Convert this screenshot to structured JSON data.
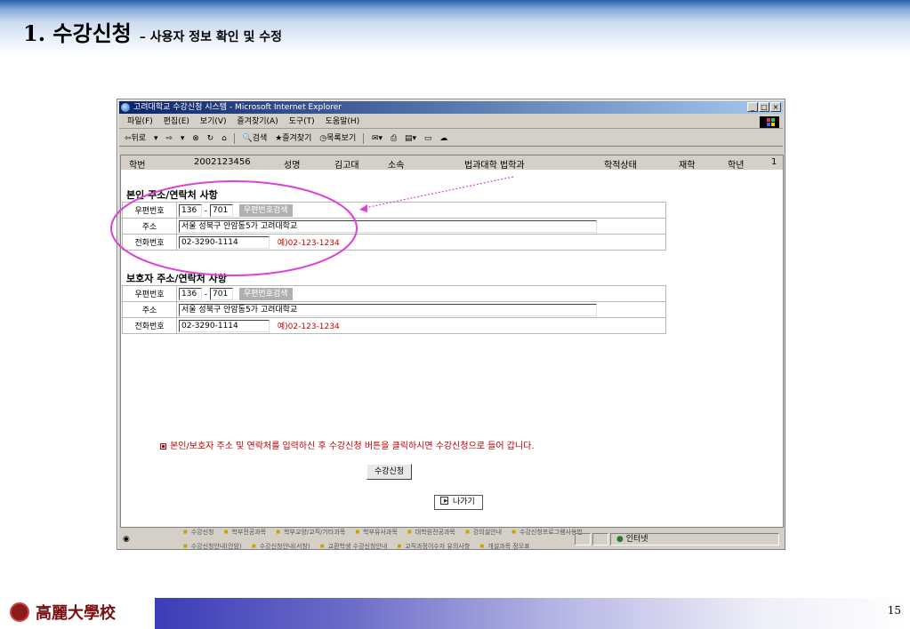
{
  "slide": {
    "title": "1. 수강신청",
    "subtitle": "– 사용자 정보 확인 및 수정",
    "page_number": "15",
    "logo_text": "高麗大學校"
  },
  "browser": {
    "title": "고려대학교 수강신청 시스템 - Microsoft Internet Explorer",
    "menu": [
      "파일(F)",
      "편집(E)",
      "보기(V)",
      "즐겨찾기(A)",
      "도구(T)",
      "도움말(H)"
    ],
    "toolbar": {
      "back": "⇦뒤로",
      "search": "검색",
      "favorites": "즐겨찾기",
      "history": "목록보기"
    },
    "status_zone": "인터넷"
  },
  "student": {
    "id_label": "학번",
    "id_value": "2002123456",
    "name_label": "성명",
    "name_value": "김고대",
    "dept_label": "소속",
    "dept_value": "법과대학 법학과",
    "status_label": "학적상태",
    "status_value": "재학",
    "year_label": "학년",
    "year_value": "1"
  },
  "self_section": {
    "title": "본인 주소/연락처 사항",
    "zip_label": "우편번호",
    "zip1": "136",
    "zip2": "701",
    "zip_button": "우편번호검색",
    "addr_label": "주소",
    "addr_value": "서울 성북구 안암동5가 고려대학교",
    "phone_label": "전화번호",
    "phone_value": "02-3290-1114",
    "phone_example": "예)02-123-1234"
  },
  "guardian_section": {
    "title": "보호자 주소/연락처 사항",
    "zip_label": "우편번호",
    "zip1": "136",
    "zip2": "701",
    "zip_button": "우편번호검색",
    "addr_label": "주소",
    "addr_value": "서울 성북구 안암동5가 고려대학교",
    "phone_label": "전화번호",
    "phone_value": "02-3290-1114",
    "phone_example": "예)02-123-1234"
  },
  "notice": "본인/보호자 주소 및 연락처를 입력하신 후 수강신청 버튼을 클릭하시면 수강신청으로 들어 갑니다.",
  "submit_button": "수강신청",
  "exit_button": "나가기",
  "links_row1": [
    "수강신청",
    "학부전공과목",
    "학부교양/교직/기타과목",
    "학부유사과목",
    "대학원전공과목",
    "강의실안내",
    "수강신청프로그램사용법"
  ],
  "links_row2": [
    "수강신청안내(안암)",
    "수강신청안내(서창)",
    "교환학생 수강신청안내",
    "교직과정이수자 유의사항",
    "개설과목 정오표"
  ],
  "colors": {
    "highlight_ellipse": "#e040d8",
    "notice_text": "#c00000",
    "title_bar": "#0a246a"
  }
}
